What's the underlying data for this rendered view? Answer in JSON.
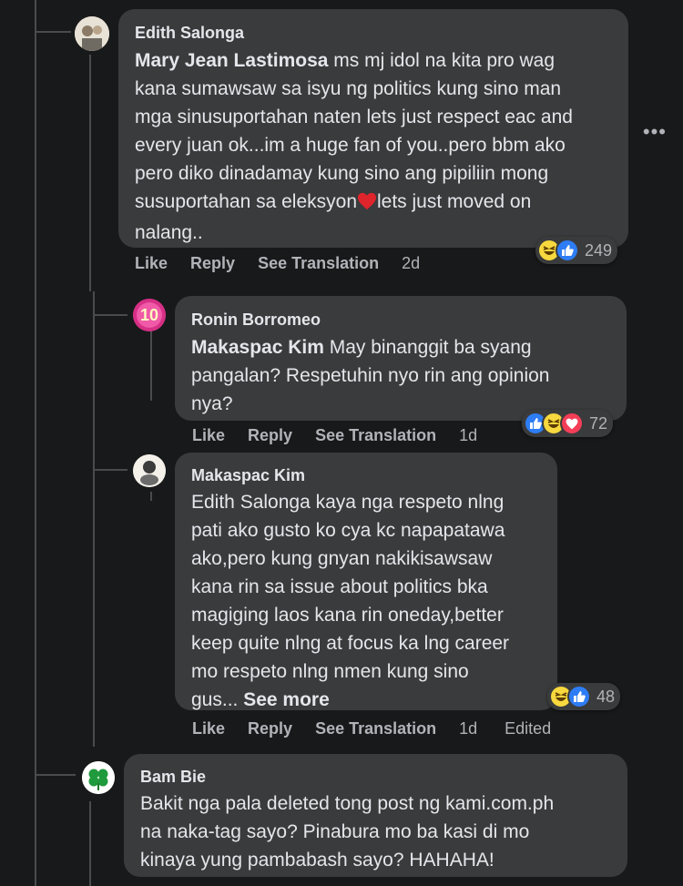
{
  "comments": [
    {
      "author": "Edith Salonga",
      "mention": "Mary Jean Lastimosa",
      "lines": [
        "ms mj idol na kita pro wag",
        "kana sumawsaw sa isyu ng politics kung sino man",
        "mga sinusuportahan naten lets just respect eac and",
        "every juan ok...im a huge fan of you..pero bbm ako",
        "pero diko dinadamay kung sino ang pipiliin mong",
        "susuportahan sa eleksyon",
        "lets just moved on",
        "nalang.."
      ],
      "actions": {
        "like": "Like",
        "reply": "Reply",
        "translate": "See Translation",
        "time": "2d"
      },
      "reaction_count": "249"
    },
    {
      "author": "Ronin Borromeo",
      "mention": "Makaspac Kim",
      "lines": [
        "May binanggit ba syang",
        "pangalan? Respetuhin nyo rin ang opinion",
        "nya?"
      ],
      "actions": {
        "like": "Like",
        "reply": "Reply",
        "translate": "See Translation",
        "time": "1d"
      },
      "reaction_count": "72",
      "avatar_badge": "10"
    },
    {
      "author": "Makaspac Kim",
      "lines": [
        "Edith Salonga kaya nga respeto nlng",
        "pati ako gusto ko cya kc napapatawa",
        "ako,pero kung gnyan nakikisawsaw",
        "kana rin sa issue about politics bka",
        "magiging laos kana rin oneday,better",
        "keep quite nlng at focus ka lng career",
        "mo respeto nlng nmen kung sino",
        "gus..."
      ],
      "see_more": "See more",
      "actions": {
        "like": "Like",
        "reply": "Reply",
        "translate": "See Translation",
        "time": "1d",
        "edited": "Edited"
      },
      "reaction_count": "48"
    },
    {
      "author": "Bam Bie",
      "lines": [
        "Bakit nga pala deleted tong post ng kami.com.ph",
        "na naka-tag sayo? Pinabura mo ba kasi di mo",
        "kinaya yung pambabash sayo? HAHAHA!"
      ]
    }
  ],
  "icons": {
    "more": "more-options-icon",
    "heart": "heart-emoji-icon",
    "haha": "haha-reaction-icon",
    "like": "like-reaction-icon",
    "love": "love-reaction-icon"
  },
  "colors": {
    "background": "#18191a",
    "bubble": "#3a3b3c",
    "text": "#e4e6eb",
    "secondary": "#b0b3b8",
    "like_blue": "#2e7df5",
    "love_red": "#f33e58",
    "haha_yellow": "#f7d83e"
  }
}
